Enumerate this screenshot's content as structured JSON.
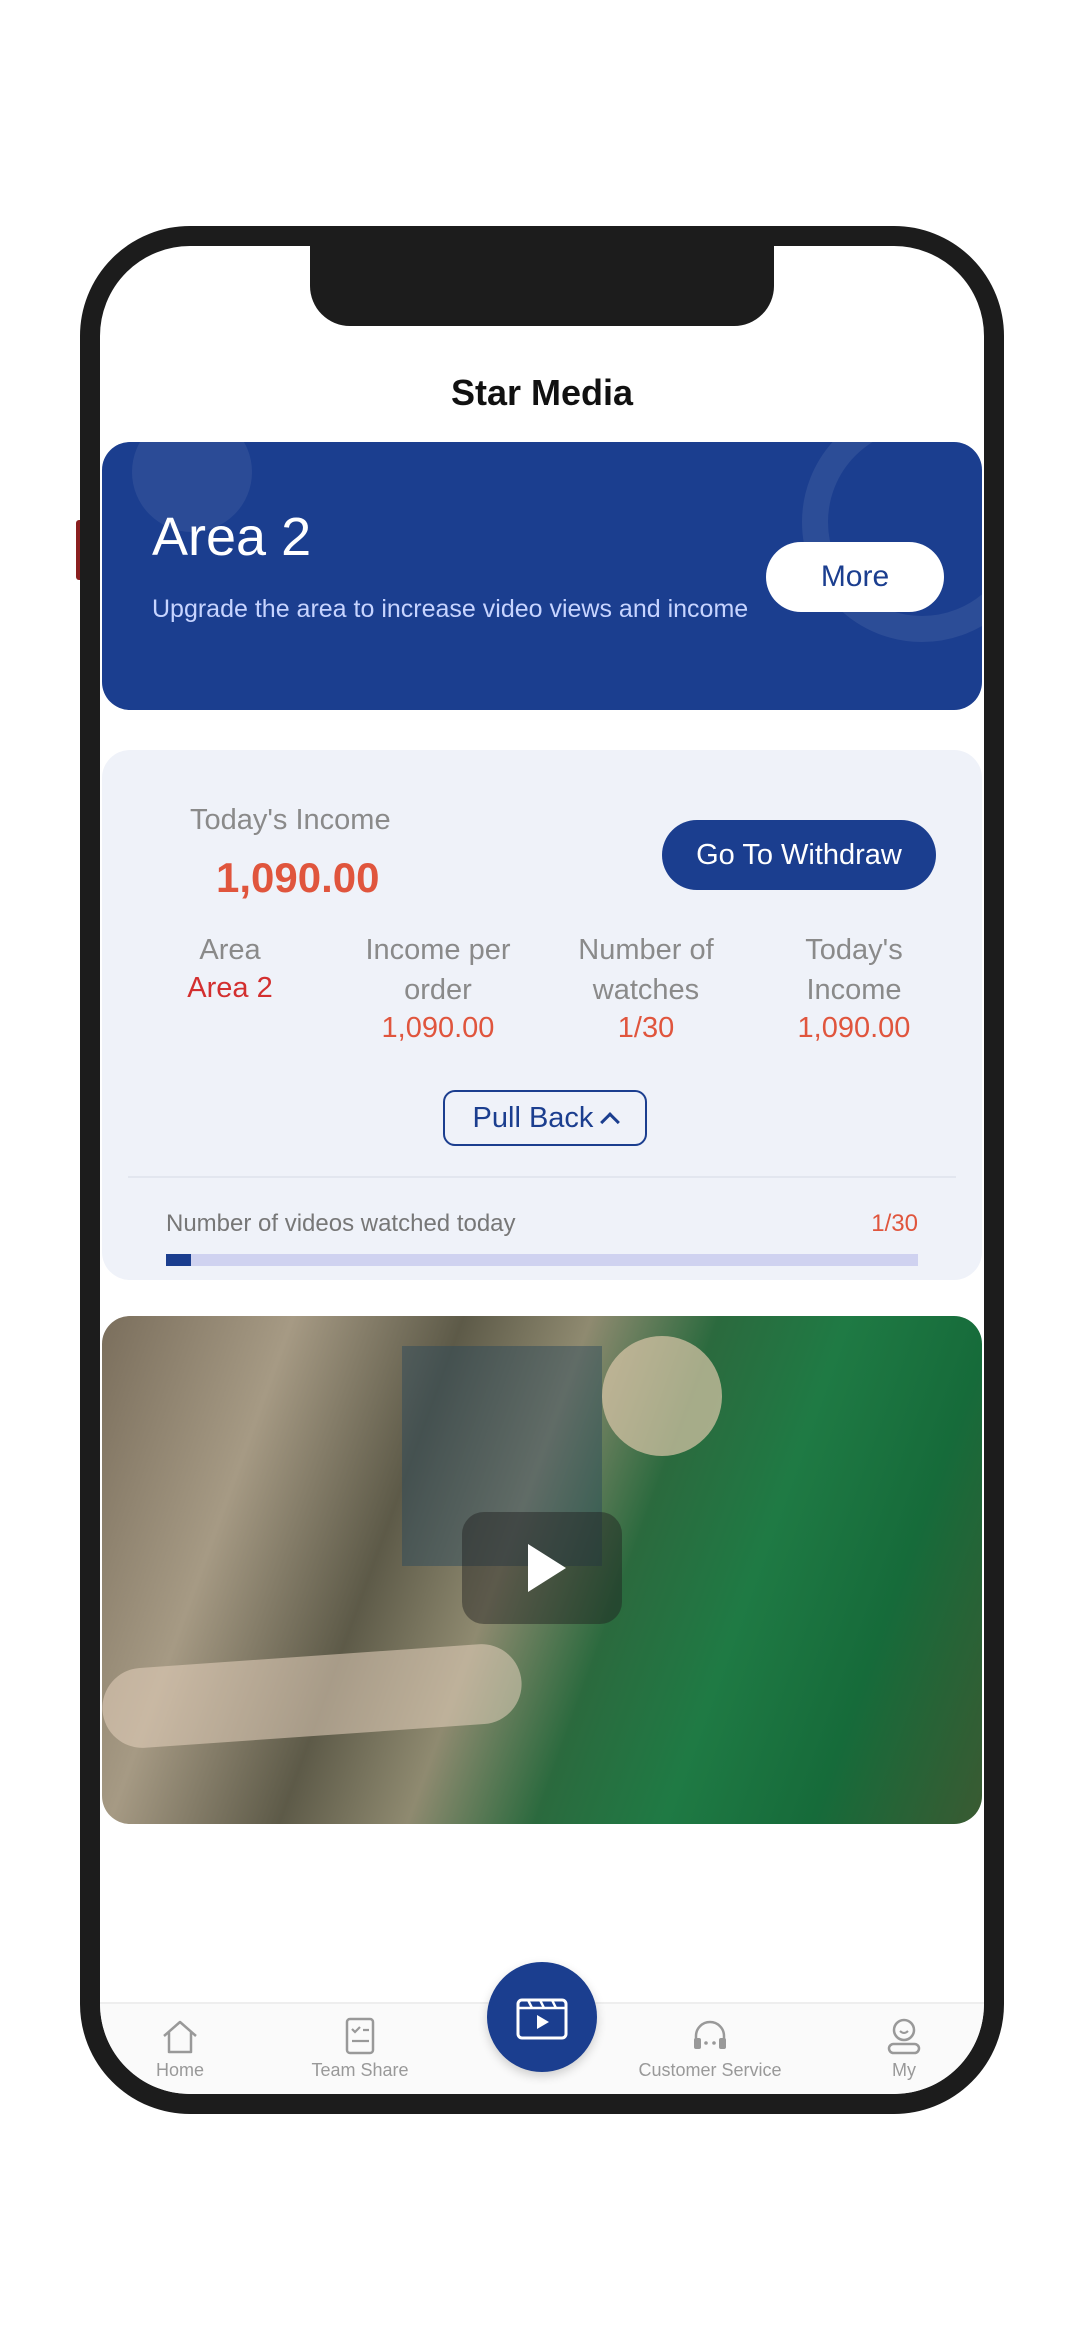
{
  "app": {
    "title": "Star Media"
  },
  "banner": {
    "title": "Area 2",
    "description": "Upgrade the area to increase video views and income",
    "more_label": "More"
  },
  "income": {
    "today_label": "Today's Income",
    "today_value": "1,090.00",
    "withdraw_label": "Go To Withdraw",
    "columns": [
      {
        "head_line1": "Area",
        "head_line2": "",
        "value": "Area 2"
      },
      {
        "head_line1": "Income per",
        "head_line2": "order",
        "value": "1,090.00"
      },
      {
        "head_line1": "Number of",
        "head_line2": "watches",
        "value": "1/30"
      },
      {
        "head_line1": "Today's",
        "head_line2": "Income",
        "value": "1,090.00"
      }
    ],
    "pull_back_label": "Pull Back",
    "watched_label": "Number of videos watched today",
    "watched_value": "1/30",
    "watched_progress_fraction": 0.0333
  },
  "video": {
    "play_icon": "play-icon"
  },
  "nav": {
    "items": [
      {
        "label": "Home",
        "icon": "home-icon"
      },
      {
        "label": "Team Share",
        "icon": "clipboard-icon"
      },
      {
        "label": "",
        "icon": "video-icon"
      },
      {
        "label": "Customer Service",
        "icon": "headset-icon"
      },
      {
        "label": "My",
        "icon": "user-icon"
      }
    ]
  },
  "colors": {
    "primary": "#1b3e8f",
    "accent": "#e0553d",
    "card_bg": "#eff2f9"
  }
}
